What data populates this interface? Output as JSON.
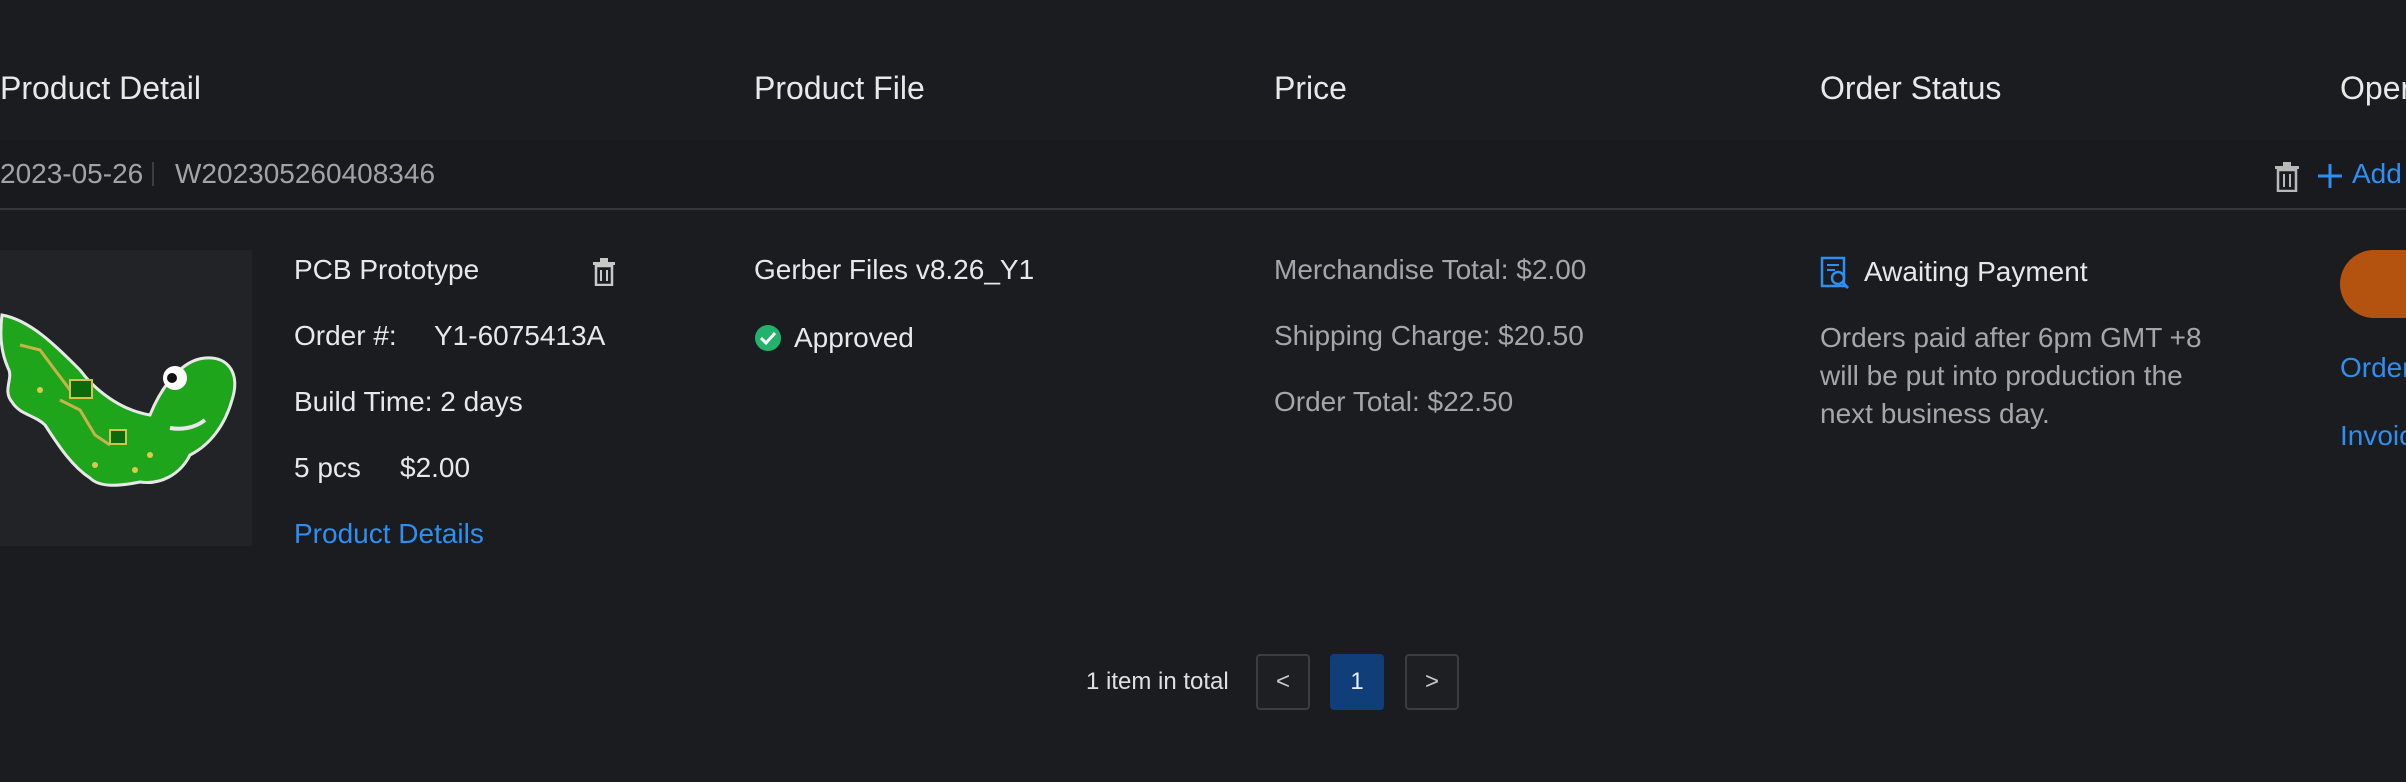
{
  "columns": {
    "product_detail": "Product Detail",
    "product_file": "Product File",
    "price": "Price",
    "order_status": "Order Status",
    "operation": "Oper"
  },
  "group": {
    "date": "2023-05-26",
    "order_no": "W202305260408346",
    "add_label": "Add"
  },
  "item": {
    "name": "PCB Prototype",
    "order_label": "Order #:",
    "order_value": "Y1-6075413A",
    "build_time": "Build Time: 2 days",
    "qty": "5 pcs",
    "unit_price": "$2.00",
    "details_link": "Product Details",
    "file_name": "Gerber Files v8.26_Y1",
    "file_status": "Approved",
    "merch_total": "Merchandise Total: $2.00",
    "shipping": "Shipping Charge: $20.50",
    "order_total": "Order Total: $22.50",
    "status": "Awaiting Payment",
    "status_note_1": "Orders paid after 6pm GMT +8",
    "status_note_2": "will be put into production the",
    "status_note_3": "next business day.",
    "op_link_1": "Order",
    "op_link_2": "Invoic"
  },
  "pagination": {
    "total_text": "1 item in total",
    "prev": "<",
    "page": "1",
    "next": ">"
  },
  "colors": {
    "background": "#1a1c1f",
    "link": "#2e8ff0",
    "pay_button": "#b4530f",
    "approved": "#23b26b",
    "active_page": "#0f3e78"
  }
}
